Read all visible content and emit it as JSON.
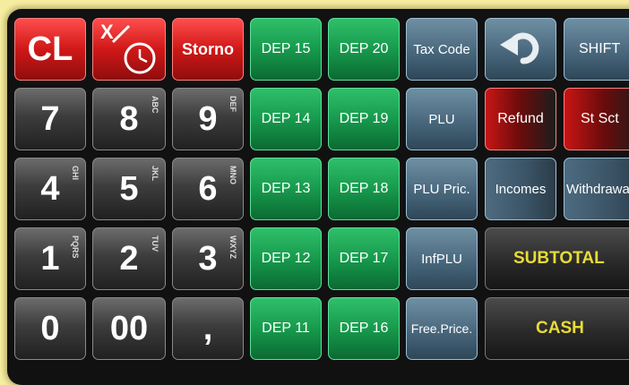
{
  "keypad": {
    "cl": "CL",
    "x": "X",
    "storno": "Storno",
    "digits": [
      {
        "digit": "7",
        "letters": ""
      },
      {
        "digit": "8",
        "letters": "ABC"
      },
      {
        "digit": "9",
        "letters": "DEF"
      },
      {
        "digit": "4",
        "letters": "GHI"
      },
      {
        "digit": "5",
        "letters": "JKL"
      },
      {
        "digit": "6",
        "letters": "MNO"
      },
      {
        "digit": "1",
        "letters": "PQRS"
      },
      {
        "digit": "2",
        "letters": "TUV"
      },
      {
        "digit": "3",
        "letters": "WXYZ"
      }
    ],
    "zero": "0",
    "double_zero": "00",
    "comma": ","
  },
  "departments": {
    "col1": [
      "DEP 15",
      "DEP 14",
      "DEP 13",
      "DEP 12",
      "DEP 11"
    ],
    "col2": [
      "DEP 20",
      "DEP 19",
      "DEP 18",
      "DEP 17",
      "DEP 16"
    ]
  },
  "functions": {
    "tax_code": "Tax Code",
    "plu": "PLU",
    "plu_price": "PLU Pric.",
    "inf_plu": "InfPLU",
    "free_price": "Free.Price.",
    "refund": "Refund",
    "st_sct": "St Sct",
    "incomes": "Incomes",
    "withdrawal": "Withdrawa",
    "shift": "SHIFT",
    "subtotal": "SUBTOTAL",
    "cash": "CASH"
  }
}
